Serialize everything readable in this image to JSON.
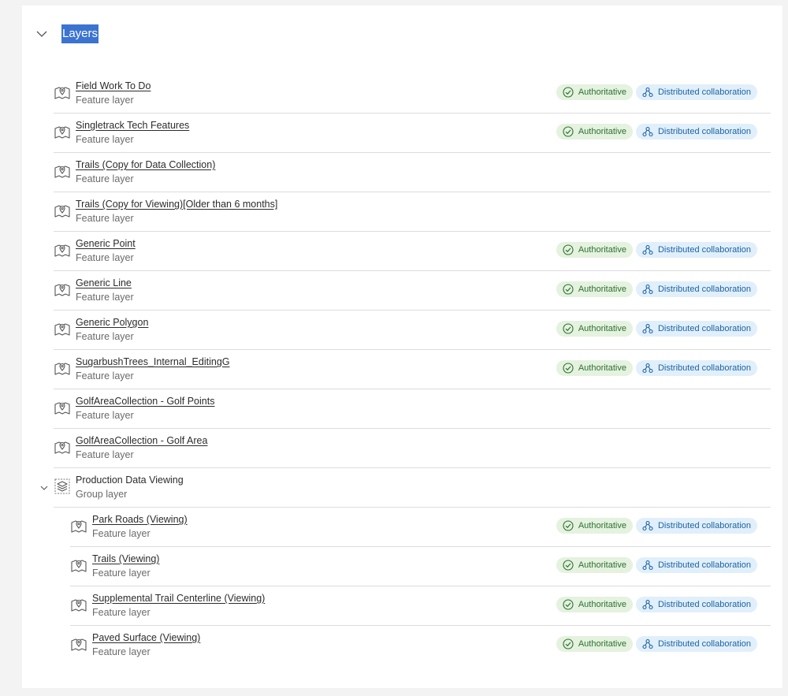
{
  "section": {
    "title": "Layers"
  },
  "badges": {
    "authoritative": "Authoritative",
    "distributed": "Distributed collaboration"
  },
  "colors": {
    "title_highlight": "#3b73d1",
    "authoritative_bg": "#e4f2df",
    "authoritative_text": "#2e7031",
    "distributed_bg": "#e1effa",
    "distributed_text": "#1c63a6"
  },
  "layers": [
    {
      "name": "Field Work To Do",
      "type": "Feature layer",
      "icon": "map-pin-icon",
      "badges": true
    },
    {
      "name": "Singletrack Tech Features",
      "type": "Feature layer",
      "icon": "map-pin-icon",
      "badges": true
    },
    {
      "name": "Trails (Copy for Data Collection)",
      "type": "Feature layer",
      "icon": "map-pin-icon",
      "badges": false
    },
    {
      "name": "Trails (Copy for Viewing)[Older than 6 months]",
      "type": "Feature layer",
      "icon": "map-pin-icon",
      "badges": false
    },
    {
      "name": "Generic Point",
      "type": "Feature layer",
      "icon": "map-pin-icon",
      "badges": true
    },
    {
      "name": "Generic Line",
      "type": "Feature layer",
      "icon": "map-pin-icon",
      "badges": true
    },
    {
      "name": "Generic Polygon",
      "type": "Feature layer",
      "icon": "map-pin-icon",
      "badges": true
    },
    {
      "name": "SugarbushTrees_Internal_EditingG",
      "type": "Feature layer",
      "icon": "map-pin-icon",
      "badges": true
    },
    {
      "name": "GolfAreaCollection - Golf Points",
      "type": "Feature layer",
      "icon": "map-pin-icon",
      "badges": false
    },
    {
      "name": "GolfAreaCollection - Golf Area",
      "type": "Feature layer",
      "icon": "map-pin-icon",
      "badges": false
    }
  ],
  "group": {
    "name": "Production Data Viewing",
    "type": "Group layer",
    "icon": "layers-stack-icon",
    "children": [
      {
        "name": "Park Roads (Viewing)",
        "type": "Feature layer",
        "icon": "map-pin-icon",
        "badges": true
      },
      {
        "name": "Trails (Viewing)",
        "type": "Feature layer",
        "icon": "map-pin-icon",
        "badges": true
      },
      {
        "name": "Supplemental Trail Centerline (Viewing)",
        "type": "Feature layer",
        "icon": "map-pin-icon",
        "badges": true
      },
      {
        "name": "Paved Surface (Viewing)",
        "type": "Feature layer",
        "icon": "map-pin-icon",
        "badges": true
      }
    ]
  }
}
